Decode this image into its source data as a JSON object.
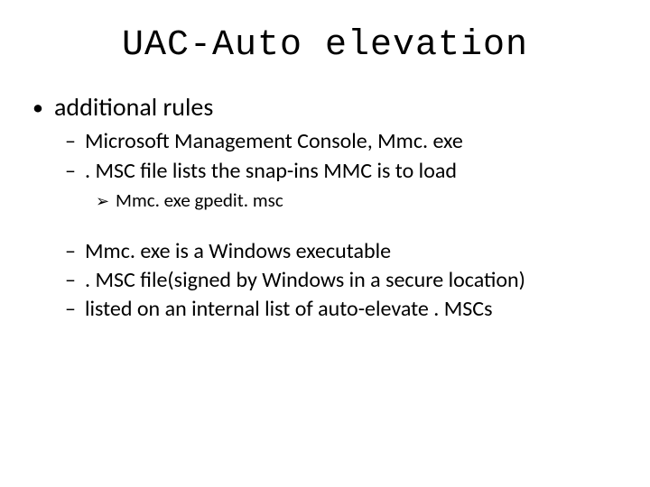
{
  "title": "UAC-Auto elevation",
  "bullets": {
    "main": "additional rules",
    "groupA": [
      "Microsoft Management Console, Mmc. exe",
      ". MSC file lists the snap-ins MMC is to load"
    ],
    "sub": "Mmc. exe gpedit. msc",
    "groupB": [
      "Mmc. exe is a Windows executable",
      ". MSC file(signed by Windows in a secure location)",
      "listed on an internal list of auto-elevate . MSCs"
    ]
  }
}
